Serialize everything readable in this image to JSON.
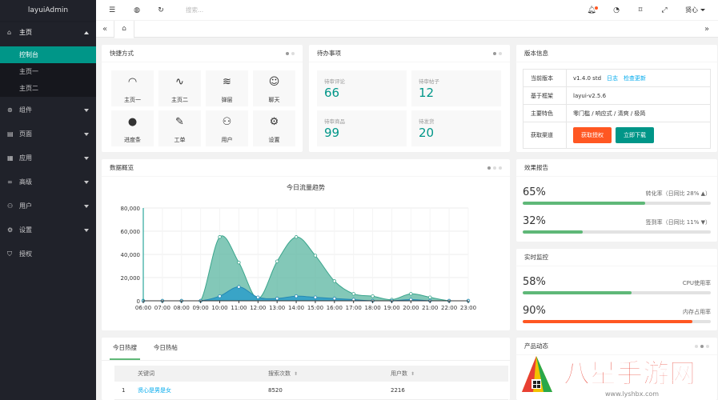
{
  "app": {
    "title": "layuiAdmin"
  },
  "sidebar": {
    "items": [
      {
        "label": "主页",
        "icon": "home-icon",
        "open": true
      },
      {
        "label": "组件",
        "icon": "component-icon"
      },
      {
        "label": "页面",
        "icon": "template-icon"
      },
      {
        "label": "应用",
        "icon": "app-icon"
      },
      {
        "label": "高级",
        "icon": "senior-icon"
      },
      {
        "label": "用户",
        "icon": "user-icon"
      },
      {
        "label": "设置",
        "icon": "set-icon"
      },
      {
        "label": "授权",
        "icon": "auz-icon"
      }
    ],
    "sub_items": [
      "控制台",
      "主页一",
      "主页二"
    ]
  },
  "header": {
    "search_placeholder": "搜索...",
    "user_name": "贤心"
  },
  "quick": {
    "title": "快捷方式",
    "items": [
      {
        "label": "主页一",
        "icon": "console-icon"
      },
      {
        "label": "主页二",
        "icon": "chart-icon"
      },
      {
        "label": "弹层",
        "icon": "layers-icon"
      },
      {
        "label": "聊天",
        "icon": "smile-icon"
      },
      {
        "label": "进度条",
        "icon": "compass-icon"
      },
      {
        "label": "工单",
        "icon": "survey-icon"
      },
      {
        "label": "用户",
        "icon": "user-icon"
      },
      {
        "label": "设置",
        "icon": "set-icon"
      }
    ]
  },
  "todo": {
    "title": "待办事项",
    "items": [
      {
        "label": "待审评论",
        "value": "66"
      },
      {
        "label": "待审帖子",
        "value": "12"
      },
      {
        "label": "待审商品",
        "value": "99"
      },
      {
        "label": "待发货",
        "value": "20"
      }
    ]
  },
  "version": {
    "title": "版本信息",
    "rows": [
      {
        "key": "当前版本",
        "value": "v1.4.0 std",
        "link1": "日志",
        "link2": "检查更新"
      },
      {
        "key": "基于框架",
        "value": "layui-v2.5.6"
      },
      {
        "key": "主要特色",
        "value": "零门槛 / 响应式 / 清爽 / 极简"
      },
      {
        "key": "获取渠道",
        "btn1": "获取授权",
        "btn2": "立即下载"
      }
    ]
  },
  "overview": {
    "title": "数据概览"
  },
  "chart_data": {
    "type": "area",
    "title": "今日流量趋势",
    "x": [
      "06:00",
      "07:00",
      "08:00",
      "09:00",
      "10:00",
      "11:00",
      "12:00",
      "13:00",
      "14:00",
      "15:00",
      "16:00",
      "17:00",
      "18:00",
      "19:00",
      "20:00",
      "21:00",
      "22:00",
      "23:00"
    ],
    "ylim": [
      0,
      80000
    ],
    "yticks": [
      "0",
      "20,000",
      "40,000",
      "60,000",
      "80,000"
    ],
    "series": [
      {
        "values": [
          0,
          0,
          0,
          0,
          55000,
          33000,
          2000,
          34000,
          55000,
          39000,
          17000,
          6000,
          4000,
          1000,
          6000,
          3000,
          0,
          0
        ]
      },
      {
        "values": [
          0,
          0,
          0,
          0,
          4000,
          12000,
          3000,
          2000,
          4000,
          3000,
          2000,
          1000,
          0,
          0,
          1000,
          0,
          0,
          0
        ]
      }
    ],
    "colors": [
      "#5ab5a0",
      "#2d9ec9"
    ],
    "grid": true
  },
  "effect": {
    "title": "效果报告",
    "items": [
      {
        "value": "65%",
        "label": "转化率（日同比 28%",
        "fraction": 0.65,
        "color": "#5fb878",
        "trend": "up"
      },
      {
        "value": "32%",
        "label": "签到率（日同比 11%",
        "fraction": 0.32,
        "color": "#5fb878",
        "trend": "down"
      }
    ]
  },
  "monitor": {
    "title": "实时监控",
    "items": [
      {
        "value": "58%",
        "label": "CPU使用率",
        "fraction": 0.58,
        "color": "#5fb878"
      },
      {
        "value": "90%",
        "label": "内存占用率",
        "fraction": 0.9,
        "color": "#ff5722"
      }
    ]
  },
  "hot": {
    "tabs": [
      "今日热搜",
      "今日热帖"
    ],
    "columns": [
      "关键词",
      "搜索次数",
      "用户数"
    ],
    "rows": [
      {
        "rank": "1",
        "keyword": "贤心是男是女",
        "count": "8520",
        "users": "2216"
      }
    ]
  },
  "product": {
    "title": "产品动态"
  },
  "watermark": {
    "text": "八星手游网",
    "url": "www.lyshbx.com"
  }
}
